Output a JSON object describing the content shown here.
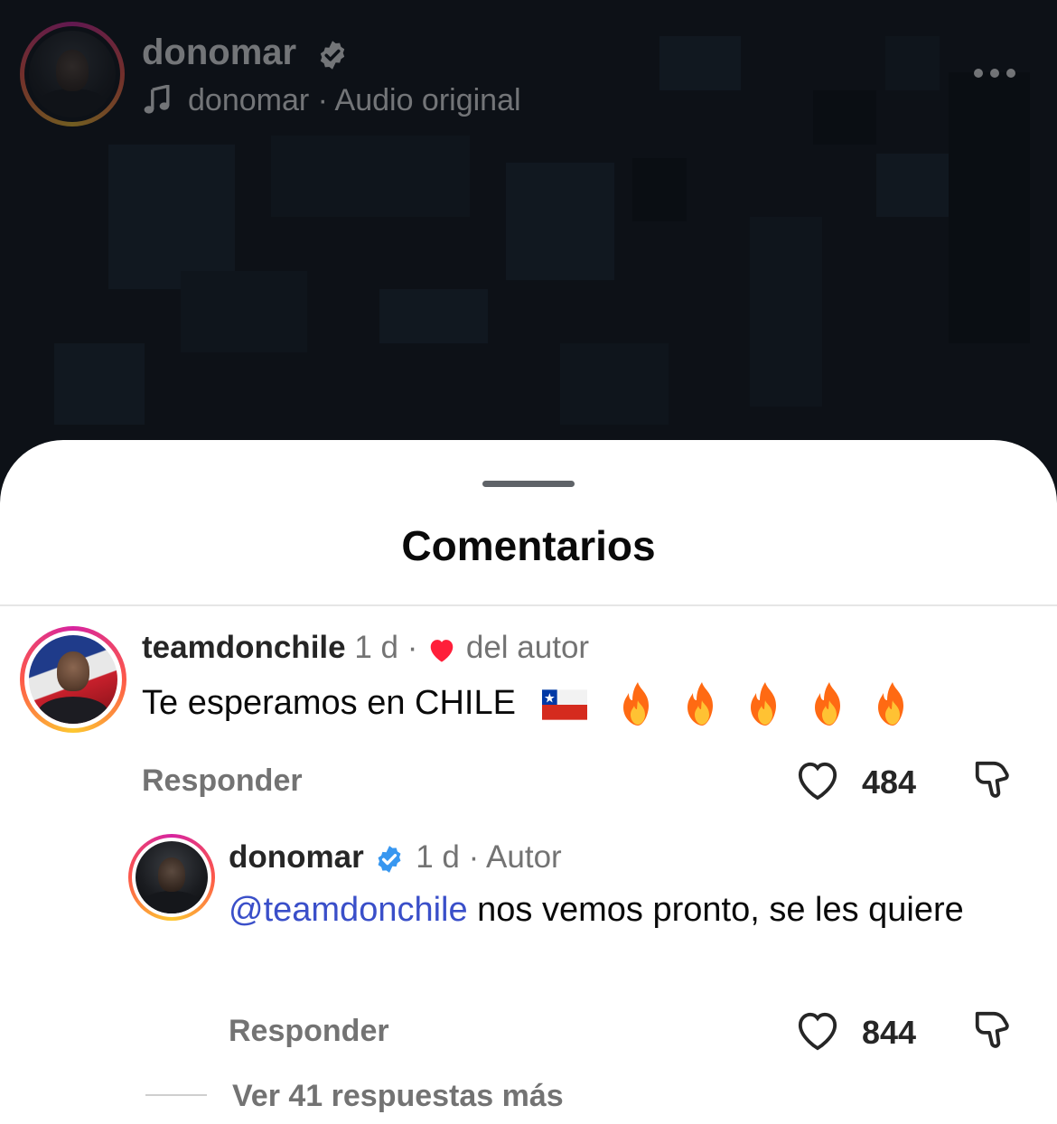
{
  "reel": {
    "username": "donomar",
    "audio_label": "donomar · Audio original"
  },
  "sheet": {
    "title": "Comentarios"
  },
  "comment1": {
    "username": "teamdonchile",
    "time": "1 d ·",
    "liked_by_author_label": "del autor",
    "text": "Te esperamos en CHILE",
    "reply_label": "Responder",
    "like_count": "484"
  },
  "comment2": {
    "username": "donomar",
    "meta": "1 d · Autor",
    "mention": "@teamdonchile",
    "text": " nos vemos pronto, se les quiere",
    "reply_label": "Responder",
    "like_count": "844"
  },
  "more_replies_label": "Ver 41 respuestas más",
  "colors": {
    "mention": "#3a4fc9",
    "heart": "#ff1f3a",
    "verified": "#3897f0"
  }
}
